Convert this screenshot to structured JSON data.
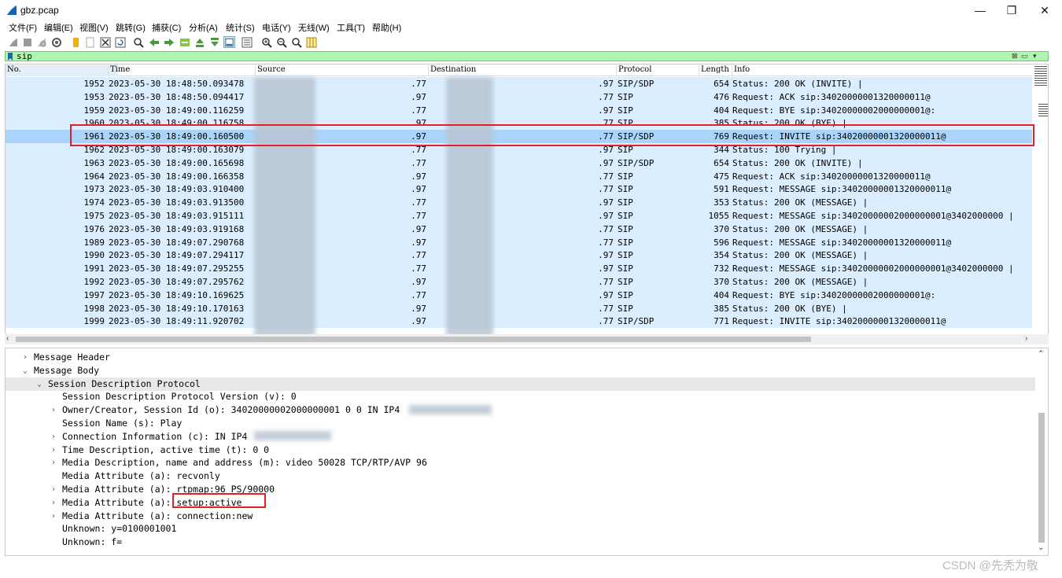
{
  "window": {
    "title": "gbz.pcap",
    "minimize": "—",
    "maximize": "❐",
    "close": "✕"
  },
  "menu": [
    "文件(F)",
    "编辑(E)",
    "视图(V)",
    "跳转(G)",
    "捕获(C)",
    "分析(A)",
    "统计(S)",
    "电话(Y)",
    "无线(W)",
    "工具(T)",
    "帮助(H)"
  ],
  "toolbar_icons": [
    "start-capture-icon",
    "stop-capture-icon",
    "restart-capture-icon",
    "capture-options-icon",
    "open-file-icon",
    "save-file-icon",
    "close-file-icon",
    "reload-icon",
    "find-packet-icon",
    "go-back-icon",
    "go-forward-icon",
    "go-to-packet-icon",
    "first-packet-icon",
    "last-packet-icon",
    "autoscroll-icon",
    "colorize-icon",
    "zoom-in-icon",
    "zoom-out-icon",
    "normal-size-icon",
    "resize-columns-icon"
  ],
  "filter": {
    "value": "sip"
  },
  "columns": {
    "no": "No.",
    "time": "Time",
    "source": "Source",
    "destination": "Destination",
    "protocol": "Protocol",
    "length": "Length",
    "info": "Info"
  },
  "packets": [
    {
      "no": "1952",
      "time": "2023-05-30 18:48:50.093478",
      "src": ".77",
      "dst": ".97",
      "proto": "SIP/SDP",
      "len": "654",
      "info": "Status: 200 OK (INVITE) |"
    },
    {
      "no": "1953",
      "time": "2023-05-30 18:48:50.094417",
      "src": ".97",
      "dst": ".77",
      "proto": "SIP",
      "len": "476",
      "info": "Request: ACK sip:34020000001320000011@"
    },
    {
      "no": "1959",
      "time": "2023-05-30 18:49:00.116259",
      "src": ".77",
      "dst": ".97",
      "proto": "SIP",
      "len": "404",
      "info": "Request: BYE sip:34020000002000000001@:"
    },
    {
      "no": "1960",
      "time": "2023-05-30 18:49:00.116758",
      "src": ".97",
      "dst": ".77",
      "proto": "SIP",
      "len": "385",
      "info": "Status: 200 OK (BYE) |"
    },
    {
      "no": "1961",
      "time": "2023-05-30 18:49:00.160500",
      "src": ".97",
      "dst": ".77",
      "proto": "SIP/SDP",
      "len": "769",
      "info": "Request: INVITE sip:34020000001320000011@"
    },
    {
      "no": "1962",
      "time": "2023-05-30 18:49:00.163079",
      "src": ".77",
      "dst": ".97",
      "proto": "SIP",
      "len": "344",
      "info": "Status: 100 Trying |"
    },
    {
      "no": "1963",
      "time": "2023-05-30 18:49:00.165698",
      "src": ".77",
      "dst": ".97",
      "proto": "SIP/SDP",
      "len": "654",
      "info": "Status: 200 OK (INVITE) |"
    },
    {
      "no": "1964",
      "time": "2023-05-30 18:49:00.166358",
      "src": ".97",
      "dst": ".77",
      "proto": "SIP",
      "len": "475",
      "info": "Request: ACK sip:34020000001320000011@"
    },
    {
      "no": "1973",
      "time": "2023-05-30 18:49:03.910400",
      "src": ".97",
      "dst": ".77",
      "proto": "SIP",
      "len": "591",
      "info": "Request: MESSAGE sip:34020000001320000011@"
    },
    {
      "no": "1974",
      "time": "2023-05-30 18:49:03.913500",
      "src": ".77",
      "dst": ".97",
      "proto": "SIP",
      "len": "353",
      "info": "Status: 200 OK (MESSAGE) |"
    },
    {
      "no": "1975",
      "time": "2023-05-30 18:49:03.915111",
      "src": ".77",
      "dst": ".97",
      "proto": "SIP",
      "len": "1055",
      "info": "Request: MESSAGE sip:34020000002000000001@3402000000 |"
    },
    {
      "no": "1976",
      "time": "2023-05-30 18:49:03.919168",
      "src": ".97",
      "dst": ".77",
      "proto": "SIP",
      "len": "370",
      "info": "Status: 200 OK (MESSAGE) |"
    },
    {
      "no": "1989",
      "time": "2023-05-30 18:49:07.290768",
      "src": ".97",
      "dst": ".77",
      "proto": "SIP",
      "len": "596",
      "info": "Request: MESSAGE sip:34020000001320000011@"
    },
    {
      "no": "1990",
      "time": "2023-05-30 18:49:07.294117",
      "src": ".77",
      "dst": ".97",
      "proto": "SIP",
      "len": "354",
      "info": "Status: 200 OK (MESSAGE) |"
    },
    {
      "no": "1991",
      "time": "2023-05-30 18:49:07.295255",
      "src": ".77",
      "dst": ".97",
      "proto": "SIP",
      "len": "732",
      "info": "Request: MESSAGE sip:34020000002000000001@3402000000 |"
    },
    {
      "no": "1992",
      "time": "2023-05-30 18:49:07.295762",
      "src": ".97",
      "dst": ".77",
      "proto": "SIP",
      "len": "370",
      "info": "Status: 200 OK (MESSAGE) |"
    },
    {
      "no": "1997",
      "time": "2023-05-30 18:49:10.169625",
      "src": ".77",
      "dst": ".97",
      "proto": "SIP",
      "len": "404",
      "info": "Request: BYE sip:34020000002000000001@:"
    },
    {
      "no": "1998",
      "time": "2023-05-30 18:49:10.170163",
      "src": ".97",
      "dst": ".77",
      "proto": "SIP",
      "len": "385",
      "info": "Status: 200 OK (BYE) |"
    },
    {
      "no": "1999",
      "time": "2023-05-30 18:49:11.920702",
      "src": ".97",
      "dst": ".77",
      "proto": "SIP/SDP",
      "len": "771",
      "info": "Request: INVITE sip:34020000001320000011@"
    }
  ],
  "details": [
    {
      "indent": 0,
      "arrow": "›",
      "text": "Message Header"
    },
    {
      "indent": 0,
      "arrow": "⌄",
      "text": "Message Body"
    },
    {
      "indent": 1,
      "arrow": "⌄",
      "text": "Session Description Protocol",
      "hl": true
    },
    {
      "indent": 2,
      "arrow": "",
      "text": "Session Description Protocol Version (v): 0"
    },
    {
      "indent": 2,
      "arrow": "›",
      "text": "Owner/Creator, Session Id (o): 34020000002000000001 0 0 IN IP4"
    },
    {
      "indent": 2,
      "arrow": "",
      "text": "Session Name (s): Play"
    },
    {
      "indent": 2,
      "arrow": "›",
      "text": "Connection Information (c): IN IP4"
    },
    {
      "indent": 2,
      "arrow": "›",
      "text": "Time Description, active time (t): 0 0"
    },
    {
      "indent": 2,
      "arrow": "›",
      "text": "Media Description, name and address (m): video 50028 TCP/RTP/AVP 96"
    },
    {
      "indent": 2,
      "arrow": "",
      "text": "Media Attribute (a): recvonly"
    },
    {
      "indent": 2,
      "arrow": "›",
      "text": "Media Attribute (a): rtpmap:96 PS/90000"
    },
    {
      "indent": 2,
      "arrow": "›",
      "text": "Media Attribute (a): setup:active"
    },
    {
      "indent": 2,
      "arrow": "›",
      "text": "Media Attribute (a): connection:new"
    },
    {
      "indent": 2,
      "arrow": "",
      "text": "Unknown: y=0100001001"
    },
    {
      "indent": 2,
      "arrow": "",
      "text": "Unknown: f="
    }
  ],
  "watermark": "CSDN @先秃为敬"
}
